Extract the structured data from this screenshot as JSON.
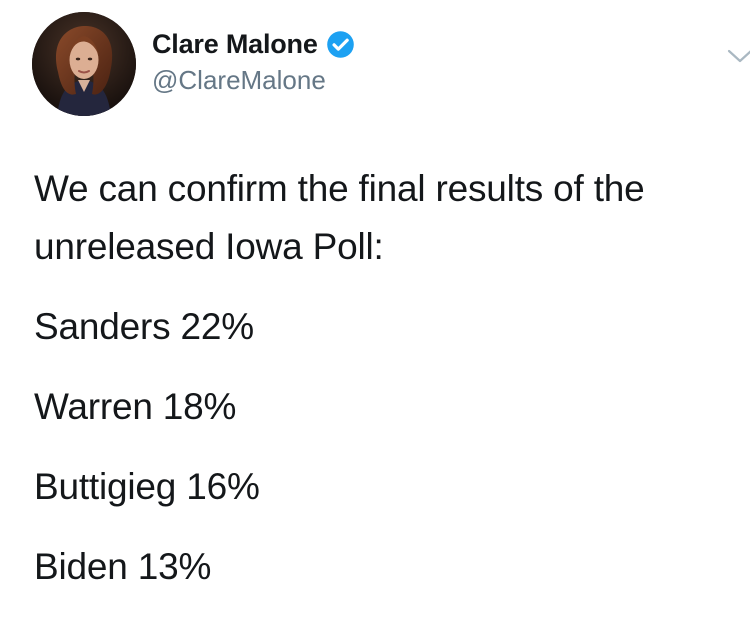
{
  "author": {
    "display_name": "Clare Malone",
    "handle": "@ClareMalone",
    "verified": true,
    "verified_color": "#1da1f2"
  },
  "icons": {
    "avatar": "avatar-photo",
    "verified": "verified-badge-icon",
    "menu": "chevron-down-icon"
  },
  "tweet": {
    "intro": "We can confirm the final results of the unreleased Iowa Poll:",
    "results": [
      "Sanders 22%",
      "Warren 18%",
      "Buttigieg 16%",
      "Biden 13%"
    ]
  },
  "colors": {
    "text": "#14171a",
    "secondary_text": "#657786",
    "chevron": "#aab8c2"
  }
}
